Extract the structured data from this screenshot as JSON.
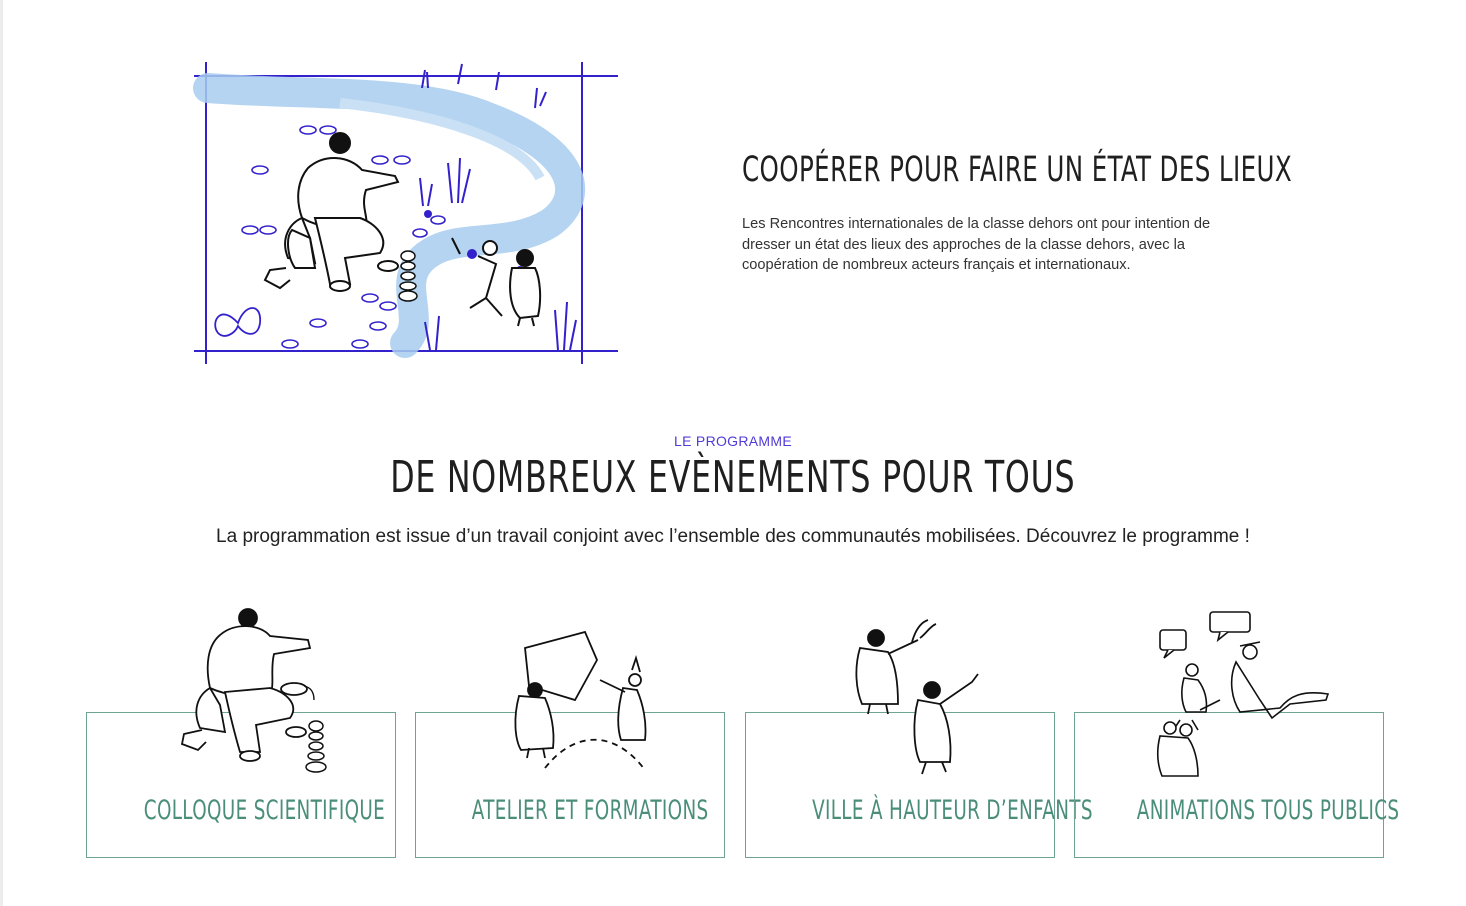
{
  "intro": {
    "title": "COOPÉRER POUR FAIRE UN ÉTAT DES LIEUX",
    "body": "Les Rencontres internationales de la classe dehors ont pour intention de dresser un état des lieux des approches de la classe dehors, avec la coopération de nombreux acteurs français et internationaux."
  },
  "programme": {
    "kicker": "LE PROGRAMME",
    "title": "DE NOMBREUX EVÈNEMENTS POUR TOUS",
    "intro": "La programmation est issue d’un travail conjoint avec l’ensemble des communautés mobilisées. Découvrez le programme !",
    "cards": [
      {
        "label": "COLLOQUE SCIENTIFIQUE"
      },
      {
        "label": "ATELIER ET FORMATIONS"
      },
      {
        "label": "VILLE À HAUTEUR D’ENFANTS"
      },
      {
        "label": "ANIMATIONS TOUS PUBLICS"
      }
    ]
  },
  "colors": {
    "accent": "#4f3bd8",
    "card_border": "#6fa392",
    "card_text": "#4a8e7a",
    "river": "#a8cdee"
  }
}
